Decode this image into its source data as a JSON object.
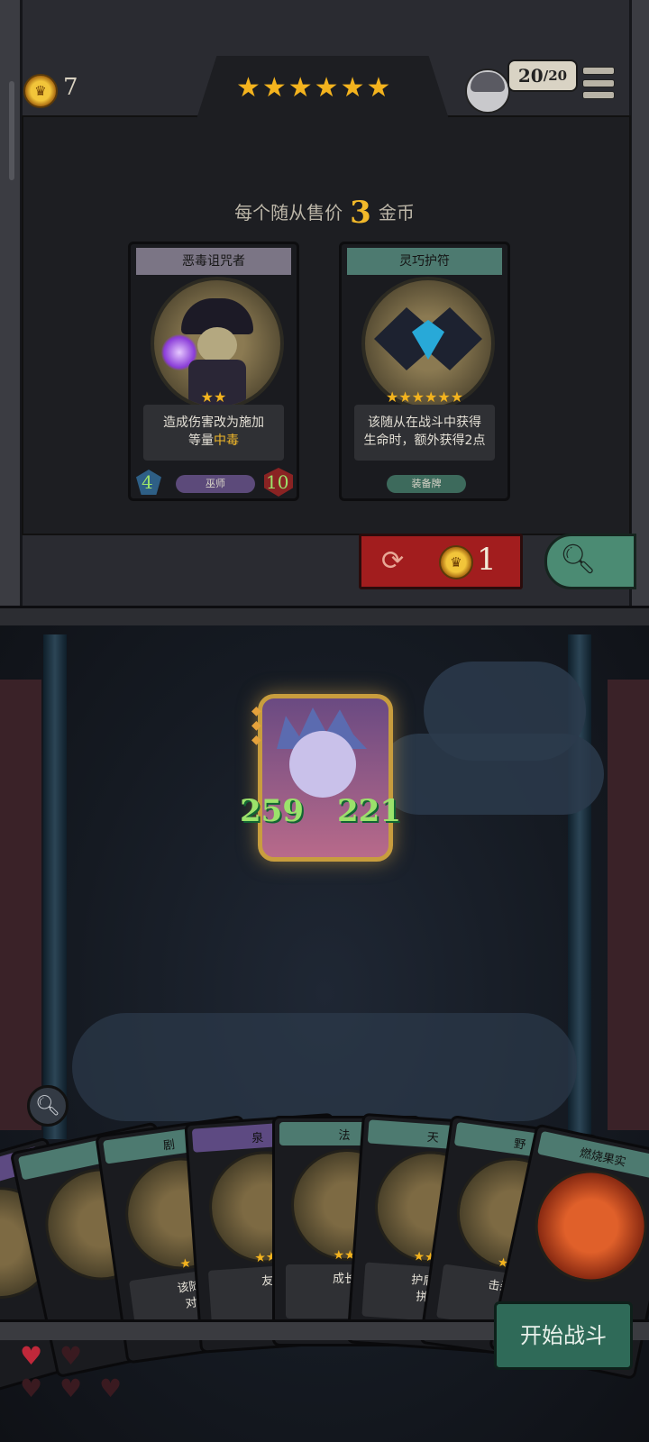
{
  "top_bar": {
    "gold": "7",
    "stars": "★★★★★★",
    "health_current": "20",
    "health_max": "/20"
  },
  "shop": {
    "sell_prefix": "每个随从售价",
    "sell_price": "3",
    "sell_suffix": "金币",
    "cards": [
      {
        "name": "恶毒诅咒者",
        "stars": "★★",
        "desc_line1": "造成伤害改为施加",
        "desc_line2_prefix": "等量",
        "desc_keyword": "中毒",
        "tribe": "巫师",
        "attack": "4",
        "health": "10"
      },
      {
        "name": "灵巧护符",
        "stars": "★★★★★★",
        "desc_line1": "该随从在战斗中获得",
        "desc_line2": "生命时，额外获得2点",
        "tribe": "装备牌"
      }
    ],
    "reroll_cost": "1"
  },
  "hero": {
    "attack": "259",
    "health": "221"
  },
  "hand": [
    {
      "name": "剧",
      "desc": "该随\n对",
      "stars": "★"
    },
    {
      "name": "泉",
      "desc": "友",
      "stars": "★★"
    },
    {
      "name": "法",
      "desc": "成长",
      "stars": "★★"
    },
    {
      "name": "天",
      "desc": "护盾\n拼",
      "stars": "★★"
    },
    {
      "name": "野",
      "desc": "击杀",
      "stars": "★"
    },
    {
      "name": "燃烧果实",
      "desc": "",
      "stars": ""
    }
  ],
  "start_button": "开始战斗",
  "colors": {
    "gold": "#f1b82a",
    "reroll_red": "#a21d1e",
    "teal": "#4d7a70",
    "stat_green": "#9be26b"
  }
}
